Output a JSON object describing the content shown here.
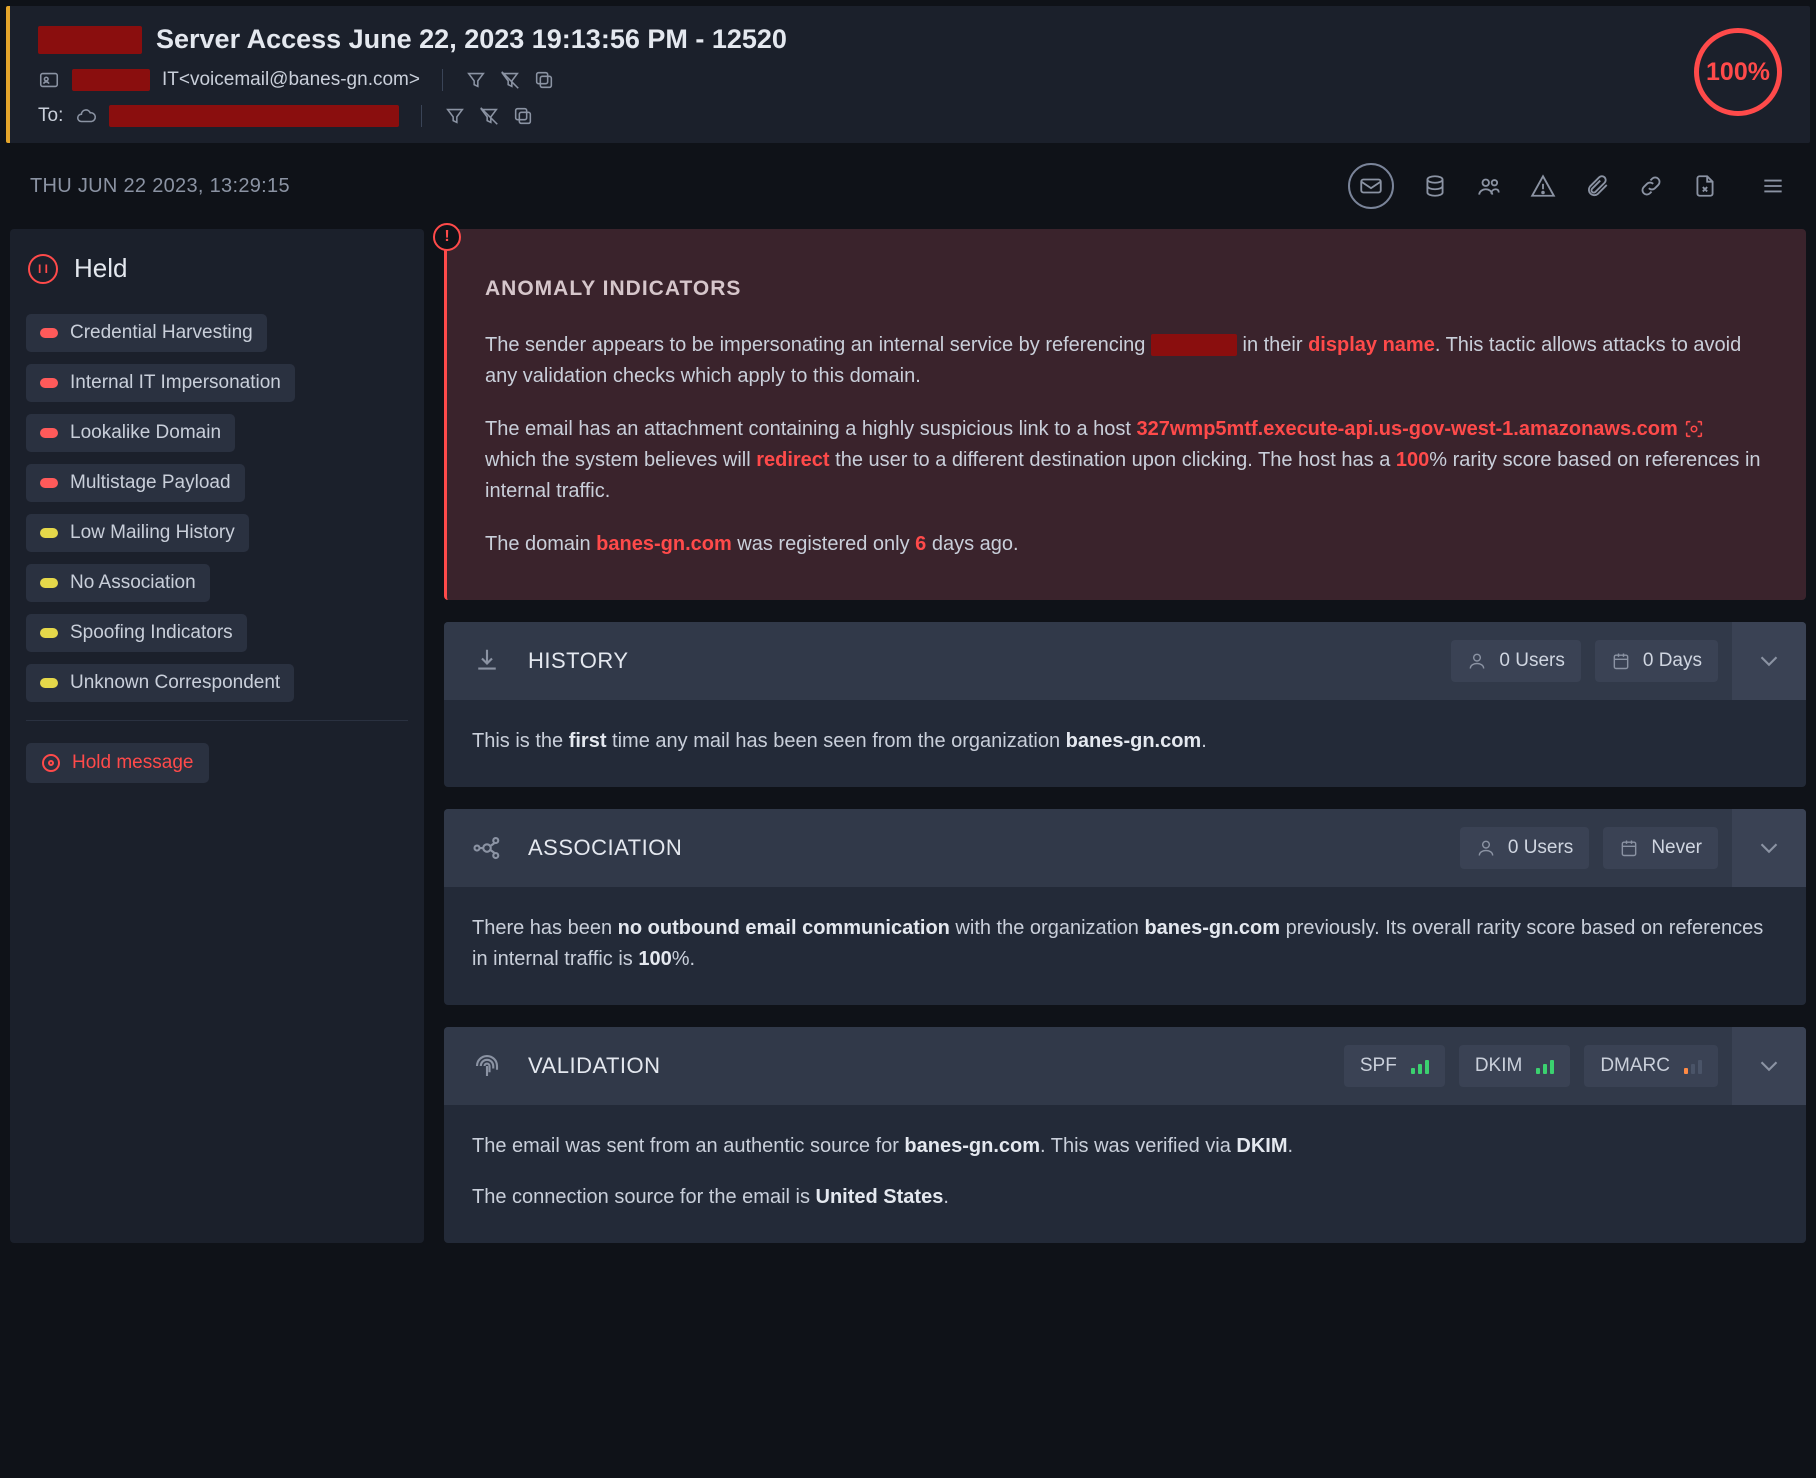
{
  "header": {
    "title": "Server Access June 22, 2023 19:13:56 PM - 12520",
    "from_display": "IT<voicemail@banes-gn.com>",
    "to_label": "To:",
    "score": "100%"
  },
  "toolbar": {
    "timestamp": "THU JUN 22 2023, 13:29:15"
  },
  "sidebar": {
    "status": "Held",
    "tags": [
      {
        "label": "Credential Harvesting",
        "sev": "red"
      },
      {
        "label": "Internal IT Impersonation",
        "sev": "red"
      },
      {
        "label": "Lookalike Domain",
        "sev": "red"
      },
      {
        "label": "Multistage Payload",
        "sev": "red"
      },
      {
        "label": "Low Mailing History",
        "sev": "yellow"
      },
      {
        "label": "No Association",
        "sev": "yellow"
      },
      {
        "label": "Spoofing Indicators",
        "sev": "yellow"
      },
      {
        "label": "Unknown Correspondent",
        "sev": "yellow"
      }
    ],
    "hold_label": "Hold message"
  },
  "anomaly": {
    "heading": "ANOMALY INDICATORS",
    "p1_a": "The sender appears to be impersonating an internal service by referencing ",
    "p1_b": " in their ",
    "p1_hl": "display name",
    "p1_c": ". This tactic allows attacks to avoid any validation checks which apply to this domain.",
    "p2_a": "The email has an attachment containing a highly suspicious link to a host ",
    "p2_host": "327wmp5mtf.execute-api.us-gov-west-1.amazonaws.com",
    "p2_b": " which the system believes will ",
    "p2_redirect": "redirect",
    "p2_c": " the user to a different destination upon clicking. The host has a ",
    "p2_score": "100",
    "p2_d": "% rarity score based on references in internal traffic.",
    "p3_a": "The domain ",
    "p3_domain": "banes-gn.com",
    "p3_b": " was registered only ",
    "p3_days": "6",
    "p3_c": " days ago."
  },
  "history": {
    "title": "HISTORY",
    "users": "0 Users",
    "days": "0 Days",
    "b1": "This is the ",
    "b1_b": "first",
    "b1_c": " time any mail has been seen from the organization ",
    "b1_d": "banes-gn.com",
    "b1_e": "."
  },
  "association": {
    "title": "ASSOCIATION",
    "users": "0 Users",
    "when": "Never",
    "b1": "There has been ",
    "b1_b": "no outbound email communication",
    "b1_c": " with the organization ",
    "b1_d": "banes-gn.com",
    "b1_e": " previously. Its overall rarity score based on references in internal traffic is ",
    "b1_f": "100",
    "b1_g": "%."
  },
  "validation": {
    "title": "VALIDATION",
    "spf": "SPF",
    "dkim": "DKIM",
    "dmarc": "DMARC",
    "b1": "The email was sent from an authentic source for ",
    "b1_b": "banes-gn.com",
    "b1_c": ". This was verified via ",
    "b1_d": "DKIM",
    "b1_e": ".",
    "b2": "The connection source for the email is ",
    "b2_b": "United States",
    "b2_c": "."
  }
}
